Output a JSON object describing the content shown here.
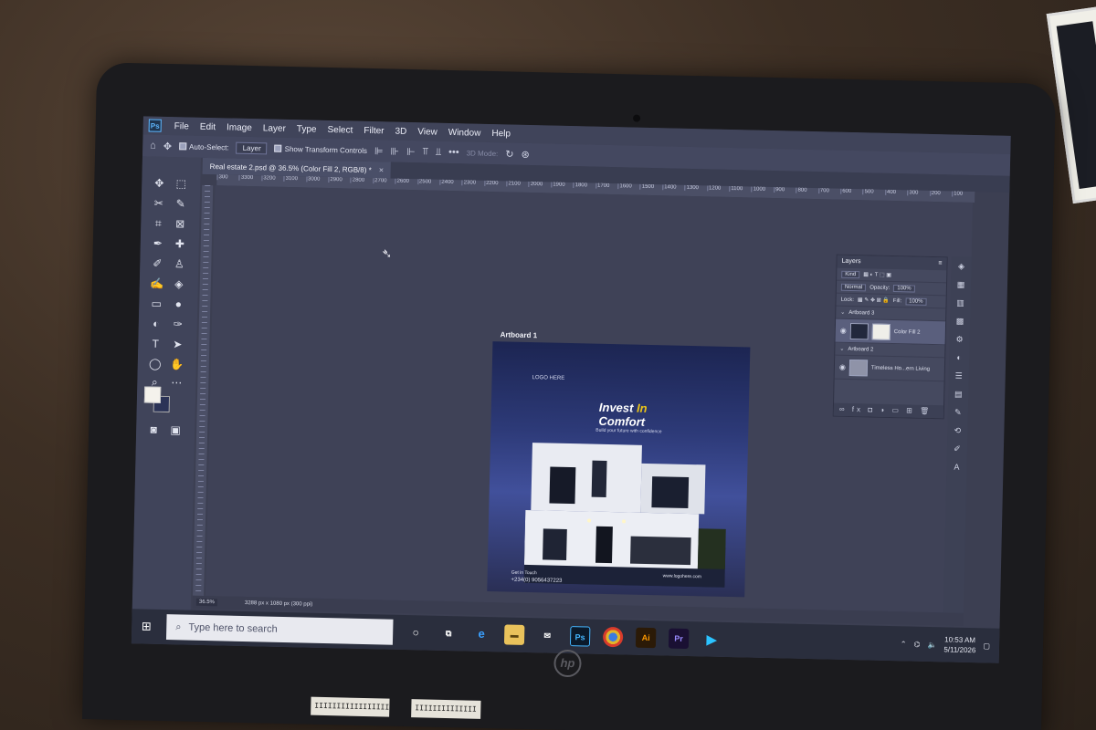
{
  "menu": [
    "File",
    "Edit",
    "Image",
    "Layer",
    "Type",
    "Select",
    "Filter",
    "3D",
    "View",
    "Window",
    "Help"
  ],
  "options": {
    "auto_select": "Auto-Select:",
    "layer_dropdown": "Layer",
    "show_transform": "Show Transform Controls",
    "mode_3d": "3D Mode:"
  },
  "document_tab": {
    "title": "Real estate 2.psd @ 36.5% (Color Fill 2, RGB/8) *",
    "close": "×"
  },
  "ruler_ticks": [
    "300",
    "3300",
    "3200",
    "3100",
    "3000",
    "2900",
    "2800",
    "2700",
    "2600",
    "2500",
    "2400",
    "2300",
    "2200",
    "2100",
    "2000",
    "1900",
    "1800",
    "1700",
    "1600",
    "1500",
    "1400",
    "1300",
    "1200",
    "1100",
    "1000",
    "900",
    "800",
    "700",
    "600",
    "500",
    "400",
    "300",
    "200",
    "100"
  ],
  "artboard": {
    "label": "Artboard 1",
    "logo": "LOGO HERE",
    "title_word1": "Invest ",
    "title_accent": "In",
    "title_line2": "Comfort",
    "tagline": "Build your future with confidence",
    "contact_label": "Get in Touch",
    "phone": "+234(0) 9056437223",
    "website": "www.logohere.com"
  },
  "layers_panel": {
    "title": "Layers",
    "kind": "Kind",
    "blend_mode": "Normal",
    "opacity_label": "Opacity:",
    "opacity_value": "100%",
    "lock_label": "Lock:",
    "fill_label": "Fill:",
    "fill_value": "100%",
    "group1": "Artboard 3",
    "layer1": "Color Fill 2",
    "group2": "Artboard 2",
    "layer2": "Timeless Ho...ern Living",
    "footer_icons": "fx"
  },
  "status_bar": {
    "zoom": "36.5%",
    "doc_size": "3288 px x 1080 px (300 ppi)"
  },
  "taskbar": {
    "search_placeholder": "Type here to search",
    "ps_label": "Ps",
    "ai_label": "Ai",
    "pr_label": "Pr",
    "time": "10:53 AM",
    "date": "5/11/2026"
  },
  "device": {
    "brand": "hp",
    "sticker1": "IIIIIIIIIIIIIIIII",
    "sticker2": "IIIIIIIIIIIIII"
  },
  "colors": {
    "foreground_swatch": "#f4f2ec",
    "background_swatch": "#2b3357",
    "accent_yellow": "#e8c21a"
  }
}
